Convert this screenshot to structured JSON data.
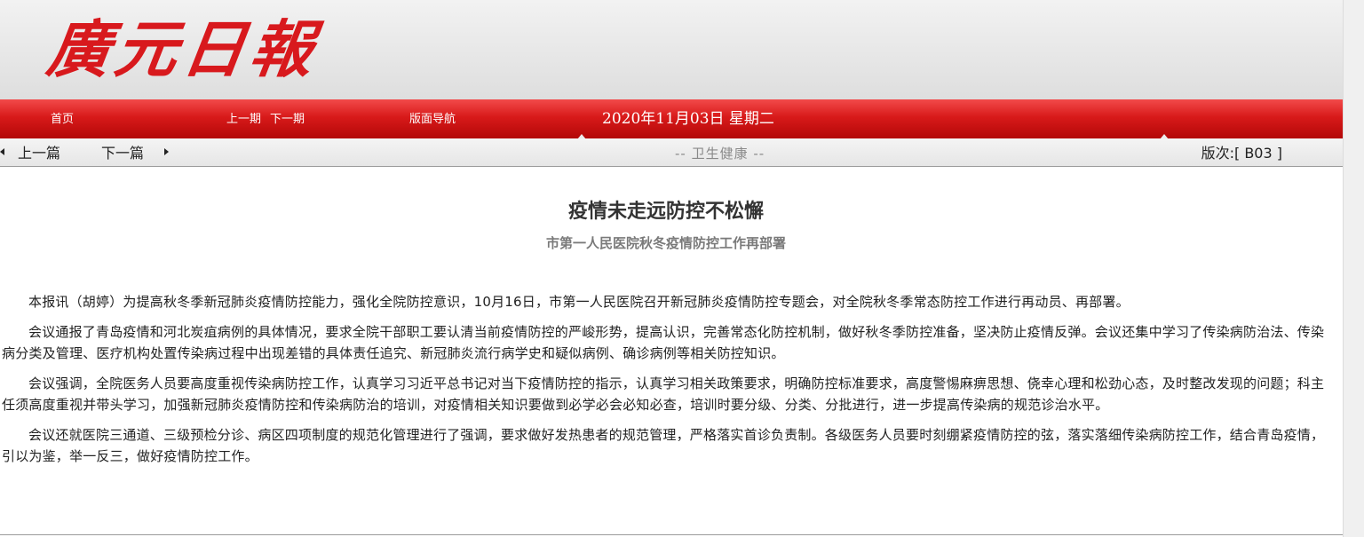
{
  "header": {
    "logo_text": "廣元日報"
  },
  "nav": {
    "home": "首页",
    "prev_issue": "上一期",
    "next_issue": "下一期",
    "layout_nav": "版面导航",
    "date": "2020年11月03日 星期二"
  },
  "subnav": {
    "prev_article": "上一篇",
    "next_article": "下一篇",
    "section": "-- 卫生健康 --",
    "edition": "版次:[ B03 ]"
  },
  "article": {
    "title": "疫情未走远防控不松懈",
    "subtitle": "市第一人民医院秋冬疫情防控工作再部署",
    "paragraphs": [
      "本报讯（胡婷）为提高秋冬季新冠肺炎疫情防控能力，强化全院防控意识，10月16日，市第一人民医院召开新冠肺炎疫情防控专题会，对全院秋冬季常态防控工作进行再动员、再部署。",
      "会议通报了青岛疫情和河北炭疽病例的具体情况，要求全院干部职工要认清当前疫情防控的严峻形势，提高认识，完善常态化防控机制，做好秋冬季防控准备，坚决防止疫情反弹。会议还集中学习了传染病防治法、传染病分类及管理、医疗机构处置传染病过程中出现差错的具体责任追究、新冠肺炎流行病学史和疑似病例、确诊病例等相关防控知识。",
      "会议强调，全院医务人员要高度重视传染病防控工作，认真学习习近平总书记对当下疫情防控的指示，认真学习相关政策要求，明确防控标准要求，高度警惕麻痹思想、侥幸心理和松劲心态，及时整改发现的问题；科主任须高度重视并带头学习，加强新冠肺炎疫情防控和传染病防治的培训，对疫情相关知识要做到必学必会必知必查，培训时要分级、分类、分批进行，进一步提高传染病的规范诊治水平。",
      "会议还就医院三通道、三级预检分诊、病区四项制度的规范化管理进行了强调，要求做好发热患者的规范管理，严格落实首诊负责制。各级医务人员要时刻绷紧疫情防控的弦，落实落细传染病防控工作，结合青岛疫情，引以为鉴，举一反三，做好疫情防控工作。"
    ]
  },
  "colors": {
    "brand_red": "#d8191d",
    "nav_red": "#d81a1a"
  }
}
